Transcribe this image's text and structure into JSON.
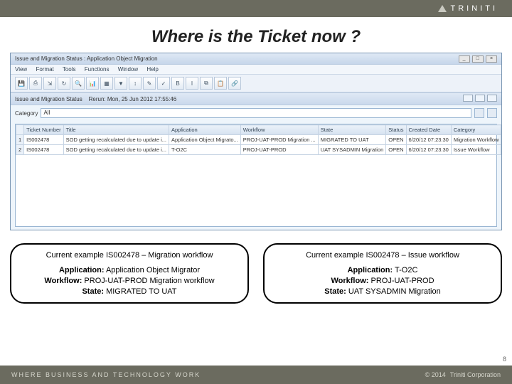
{
  "top": {
    "brand": "TRINITI"
  },
  "slide": {
    "title": "Where is the Ticket now ?"
  },
  "win": {
    "title": "Issue and Migration Status : Application Object Migration",
    "menus": [
      "View",
      "Format",
      "Tools",
      "Functions",
      "Window",
      "Help"
    ],
    "sub_title": "Issue and Migration Status",
    "sub_time": "Rerun: Mon, 25 Jun 2012 17:55:46",
    "category_label": "Category",
    "category_value": "All"
  },
  "grid": {
    "headers": [
      "Ticket Number",
      "Title",
      "Application",
      "Workflow",
      "State",
      "Status",
      "Created Date",
      "Category"
    ],
    "rows": [
      {
        "n": "1",
        "ticket": "IS002478",
        "title": "SOD getting recalculated due to update i...",
        "app": "Application Object Migrato...",
        "wf": "PROJ-UAT-PROD Migration ...",
        "state": "MIGRATED TO UAT",
        "status": "OPEN",
        "date": "6/20/12 07:23:30",
        "cat": "Migration Workflow"
      },
      {
        "n": "2",
        "ticket": "IS002478",
        "title": "SOD getting recalculated due to update i...",
        "app": "T-O2C",
        "wf": "PROJ-UAT-PROD",
        "state": "UAT SYSADMIN Migration",
        "status": "OPEN",
        "date": "6/20/12 07:23:30",
        "cat": "Issue Workflow"
      }
    ]
  },
  "callouts": {
    "left": {
      "head": "Current example IS002478 – Migration workflow",
      "l1a": "Application:",
      "l1b": " Application Object Migrator",
      "l2a": "Workflow:",
      "l2b": " PROJ-UAT-PROD Migration workflow",
      "l3a": "State:",
      "l3b": " MIGRATED TO UAT"
    },
    "right": {
      "head": "Current example IS002478 – Issue workflow",
      "l1a": "Application:",
      "l1b": " T-O2C",
      "l2a": "Workflow:",
      "l2b": " PROJ-UAT-PROD",
      "l3a": "State:",
      "l3b": " UAT SYSADMIN Migration"
    }
  },
  "footer": {
    "tagline": "WHERE BUSINESS AND TECHNOLOGY WORK",
    "copyright": "© 2014",
    "company": "Triniti Corporation",
    "page": "8"
  }
}
